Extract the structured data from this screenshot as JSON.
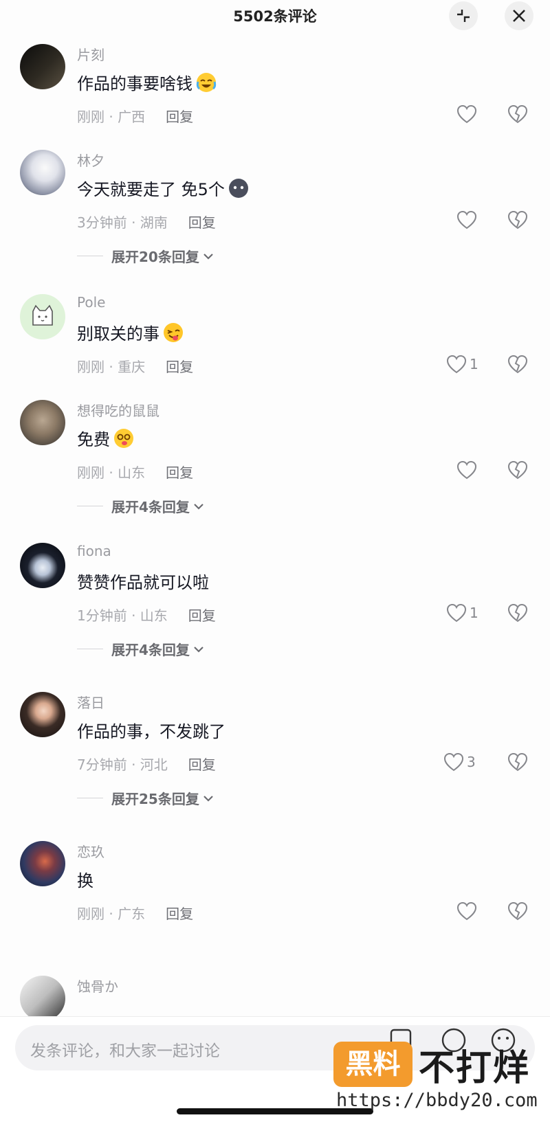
{
  "header": {
    "title": "5502条评论"
  },
  "comments": [
    {
      "user": "片刻",
      "text": "作品的事要啥钱",
      "emoji": "crying-laughing-emoji",
      "time": "刚刚 · 广西",
      "reply": "回复",
      "likes": "",
      "expand": ""
    },
    {
      "user": "林夕",
      "text": "今天就要走了  免5个",
      "emoji": "dark-blob-emoji",
      "time": "3分钟前 · 湖南",
      "reply": "回复",
      "likes": "",
      "expand": "展开20条回复"
    },
    {
      "user": "Pole",
      "text": "别取关的事",
      "emoji": "winking-tongue-emoji",
      "time": "刚刚 · 重庆",
      "reply": "回复",
      "likes": "1",
      "expand": ""
    },
    {
      "user": "想得吃的鼠鼠",
      "text": "免费",
      "emoji": "dizzy-face-emoji",
      "time": "刚刚 · 山东",
      "reply": "回复",
      "likes": "",
      "expand": "展开4条回复"
    },
    {
      "user": "fiona",
      "text": "赞赞作品就可以啦",
      "emoji": "",
      "time": "1分钟前 · 山东",
      "reply": "回复",
      "likes": "1",
      "expand": "展开4条回复"
    },
    {
      "user": "落日",
      "text": "作品的事，不发跳了",
      "emoji": "",
      "time": "7分钟前 · 河北",
      "reply": "回复",
      "likes": "3",
      "expand": "展开25条回复"
    },
    {
      "user": "恋玖",
      "text": "换",
      "emoji": "",
      "time": "刚刚 · 广东",
      "reply": "回复",
      "likes": "",
      "expand": ""
    },
    {
      "user": "蚀骨か",
      "text": "",
      "emoji": "",
      "time": "",
      "reply": "",
      "likes": "",
      "expand": ""
    }
  ],
  "input": {
    "placeholder": "发条评论，和大家一起讨论"
  },
  "watermark": {
    "badge": "黑料",
    "text": "不打烊",
    "url": "https://bbdy20.com"
  },
  "colors": {
    "background": "#fdfdfd",
    "text": "#161823",
    "muted": "#a7a8ad",
    "watermark_orange": "#f39b2d"
  }
}
